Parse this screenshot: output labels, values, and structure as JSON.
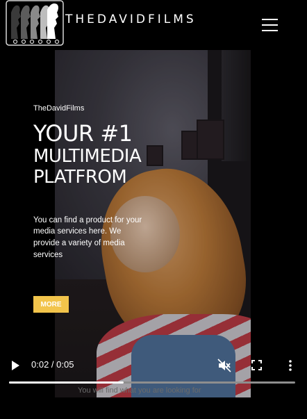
{
  "header": {
    "brand": "THEDAVIDFILMS",
    "logo_icon": "film-strip-silhouette-logo",
    "menu_icon": "hamburger-menu-icon"
  },
  "hero": {
    "eyebrow": "TheDavidFilms",
    "headline_line1": "Your #1",
    "headline_line2": "Multimedia",
    "headline_line3": "Platfrom",
    "description": "You can find a product for your media services here. We provide a variety of media services",
    "more_label": "MORE",
    "more_color": "#f2c44b"
  },
  "video": {
    "current_time": "0:02",
    "duration": "0:05",
    "time_display": "0:02 / 0:05",
    "progress": 0.4,
    "play_icon": "play-icon",
    "mute_icon": "muted-speaker-icon",
    "fullscreen_icon": "fullscreen-icon",
    "more_options_icon": "more-options-icon"
  },
  "below_video_text": "You will find what you are looking for"
}
